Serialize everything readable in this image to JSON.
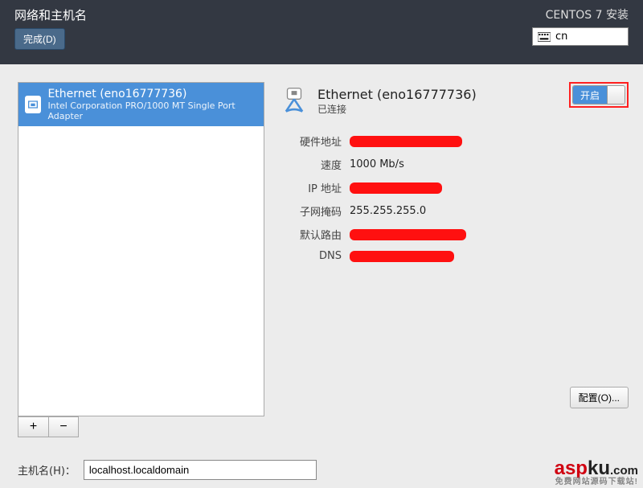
{
  "header": {
    "title": "网络和主机名",
    "done_label": "完成(D)",
    "os_label": "CENTOS 7 安装",
    "lang_code": "cn"
  },
  "sidebar": {
    "device_name": "Ethernet (eno16777736)",
    "device_sub": "Intel Corporation PRO/1000 MT Single Port Adapter",
    "plus": "+",
    "minus": "−"
  },
  "detail": {
    "title": "Ethernet (eno16777736)",
    "status": "已连接",
    "toggle_label": "开启",
    "rows": {
      "mac_label": "硬件地址",
      "speed_label": "速度",
      "speed_value": "1000 Mb/s",
      "ip_label": "IP 地址",
      "mask_label": "子网掩码",
      "mask_value": "255.255.255.0",
      "gateway_label": "默认路由",
      "dns_label": "DNS"
    },
    "config_label": "配置(O)..."
  },
  "hostname": {
    "label": "主机名(H)：",
    "value": "localhost.localdomain"
  },
  "watermark": {
    "brand_a": "asp",
    "brand_b": "ku",
    "brand_dot": ".com",
    "sub": "免费网站源码下载站!"
  }
}
